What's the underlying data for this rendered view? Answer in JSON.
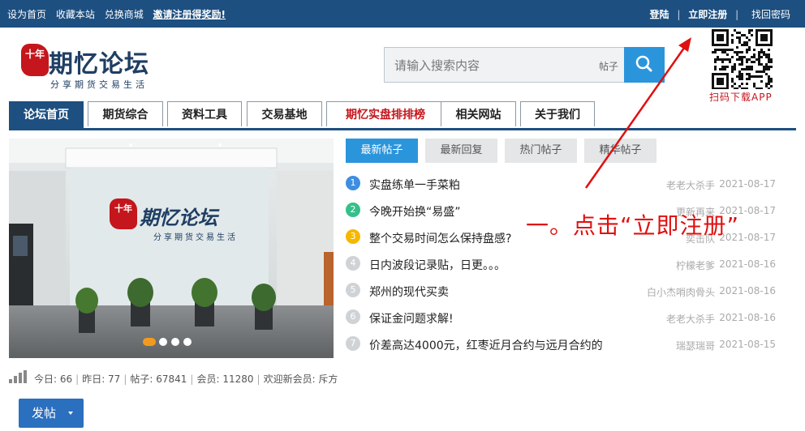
{
  "topbar": {
    "links_left": [
      "设为首页",
      "收藏本站",
      "兑换商城"
    ],
    "promo": "邀请注册得奖励!",
    "login": "登陆",
    "register": "立即注册",
    "separator": "|",
    "forgot": "找回密码"
  },
  "logo": {
    "badge": "十年",
    "name": "期忆论坛",
    "slogan": "分享期货交易生活"
  },
  "search": {
    "placeholder": "请输入搜索内容",
    "scope": "帖子"
  },
  "qr": {
    "caption": "扫码下载APP"
  },
  "nav": {
    "tabs": [
      {
        "label": "论坛首页"
      },
      {
        "label": "期货综合"
      },
      {
        "label": "资料工具"
      },
      {
        "label": "交易基地"
      },
      {
        "label": "期忆实盘排排榜"
      },
      {
        "label": "相关网站"
      },
      {
        "label": "关于我们"
      }
    ]
  },
  "slider": {
    "wall_logo_badge": "十年",
    "wall_logo_name": "期忆论坛",
    "wall_slogan": "分享期货交易生活",
    "dots": 4,
    "active_dot": 1
  },
  "post_tabs": [
    "最新帖子",
    "最新回复",
    "热门帖子",
    "精华帖子"
  ],
  "posts": [
    {
      "num": "1",
      "title": "实盘练单一手菜粕",
      "author": "老老大杀手",
      "date": "2021-08-17",
      "color": "#3e8ee0"
    },
    {
      "num": "2",
      "title": "今晚开始换“易盛”",
      "author": "更新再来",
      "date": "2021-08-17",
      "color": "#34c08a"
    },
    {
      "num": "3",
      "title": "整个交易时间怎么保持盘感?",
      "author": "奕击队",
      "date": "2021-08-17",
      "color": "#f5b800"
    },
    {
      "num": "4",
      "title": "日内波段记录贴，日更。。。",
      "author": "柠檬老爹",
      "date": "2021-08-16",
      "color": "#d0d3d6"
    },
    {
      "num": "5",
      "title": "郑州的现代买卖",
      "author": "白小杰哨肉骨头",
      "date": "2021-08-16",
      "color": "#d0d3d6"
    },
    {
      "num": "6",
      "title": "保证金问题求解!",
      "author": "老老大杀手",
      "date": "2021-08-16",
      "color": "#d0d3d6"
    },
    {
      "num": "7",
      "title": "价差高达4000元，红枣近月合约与远月合约的",
      "author": "瑞瑟瑞哥",
      "date": "2021-08-15",
      "color": "#d0d3d6"
    }
  ],
  "stats": {
    "today": "今日: 66",
    "yesterday": "昨日: 77",
    "posts": "帖子: 67841",
    "members": "会员: 11280",
    "newest": "欢迎新会员: 斥方"
  },
  "post_button": {
    "label": "发帖"
  },
  "annotation": {
    "text": "一。点击“立即注册”",
    "color": "#e01010"
  }
}
